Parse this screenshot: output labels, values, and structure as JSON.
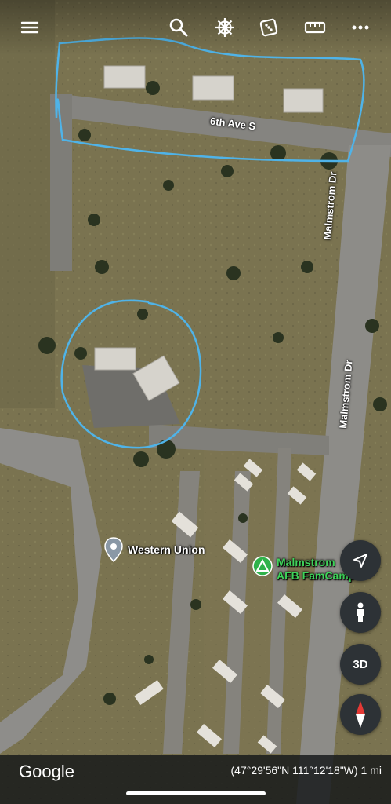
{
  "toolbar": {
    "menu_icon": "hamburger-menu-icon",
    "search_icon": "search-icon",
    "voyager_icon": "ships-wheel-icon",
    "feeling_lucky_icon": "dice-icon",
    "measure_icon": "ruler-icon",
    "more_icon": "more-dots-icon"
  },
  "map": {
    "roads": {
      "sixth_ave": "6th Ave S",
      "malmstrom_upper": "Malmstrom Dr",
      "malmstrom_lower": "Malmstrom Dr"
    },
    "places": {
      "western_union": "Western Union",
      "famcamp_line1": "Malmstrom",
      "famcamp_line2": "AFB FamCamp"
    },
    "colors": {
      "annotation": "#4fb3e8",
      "famcamp_pin": "#2fb24a",
      "place_pin": "#8a98a6"
    }
  },
  "controls": {
    "location_icon": "navigation-arrow-icon",
    "pegman_icon": "pegman-icon",
    "toggle_3d": "3D",
    "compass_icon": "compass-icon"
  },
  "footer": {
    "logo": "Google",
    "coordinates": "(47°29'56\"N 111°12'18\"W) 1 mi"
  }
}
